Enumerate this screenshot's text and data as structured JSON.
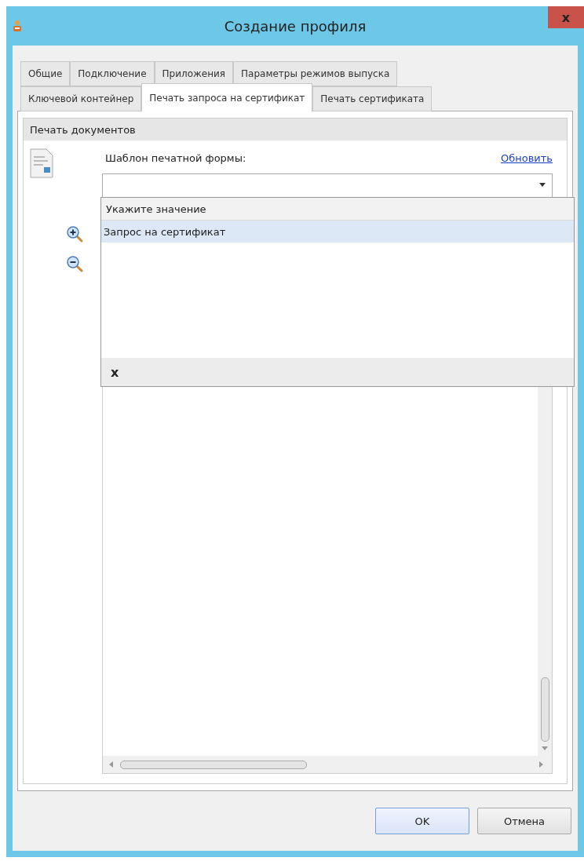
{
  "window": {
    "title": "Создание профиля",
    "close_label": "x"
  },
  "tab_rows": [
    [
      {
        "label": "Общие",
        "selected": false
      },
      {
        "label": "Подключение",
        "selected": false
      },
      {
        "label": "Приложения",
        "selected": false
      },
      {
        "label": "Параметры режимов выпуска",
        "selected": false
      }
    ],
    [
      {
        "label": "Ключевой контейнер",
        "selected": false
      },
      {
        "label": "Печать запроса на сертификат",
        "selected": true
      },
      {
        "label": "Печать сертификата",
        "selected": false
      }
    ]
  ],
  "group": {
    "title": "Печать документов",
    "template_label": "Шаблон печатной формы:",
    "refresh_link": "Обновить"
  },
  "dropdown_list": {
    "items": [
      {
        "label": "Укажите значение",
        "kind": "placeholder",
        "selected": false
      },
      {
        "label": "Запрос на сертификат",
        "kind": "option",
        "selected": true
      }
    ],
    "clear_label": "x"
  },
  "buttons": [
    {
      "label": "OK",
      "default": true
    },
    {
      "label": "Отмена",
      "default": false
    }
  ]
}
